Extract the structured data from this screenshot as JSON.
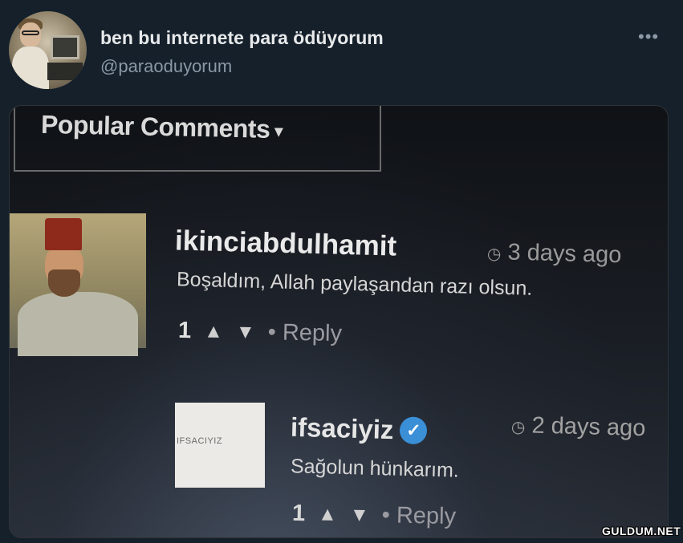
{
  "tweet": {
    "display_name": "ben bu internete para ödüyorum",
    "handle": "@paraoduyorum",
    "more_icon": "more-options-icon"
  },
  "media": {
    "sort_label": "Popular Comments",
    "sort_caret": "▾",
    "comments": [
      {
        "user": "ikinciabdulhamit",
        "time": "3 days ago",
        "text": "Boşaldım, Allah paylaşandan razı olsun.",
        "likes": "1",
        "reply": "• Reply"
      },
      {
        "user": "ifsaciyiz",
        "avatar_text": "IFSACIYIZ",
        "time": "2 days ago",
        "text": "Sağolun hünkarım.",
        "likes": "1",
        "reply": "• Reply"
      }
    ],
    "clock_glyph": "🕒"
  },
  "watermark": "GULDUM.NET",
  "colors": {
    "background": "#15202b",
    "handle": "#8b98a5",
    "verified": "#3a8fd6"
  }
}
